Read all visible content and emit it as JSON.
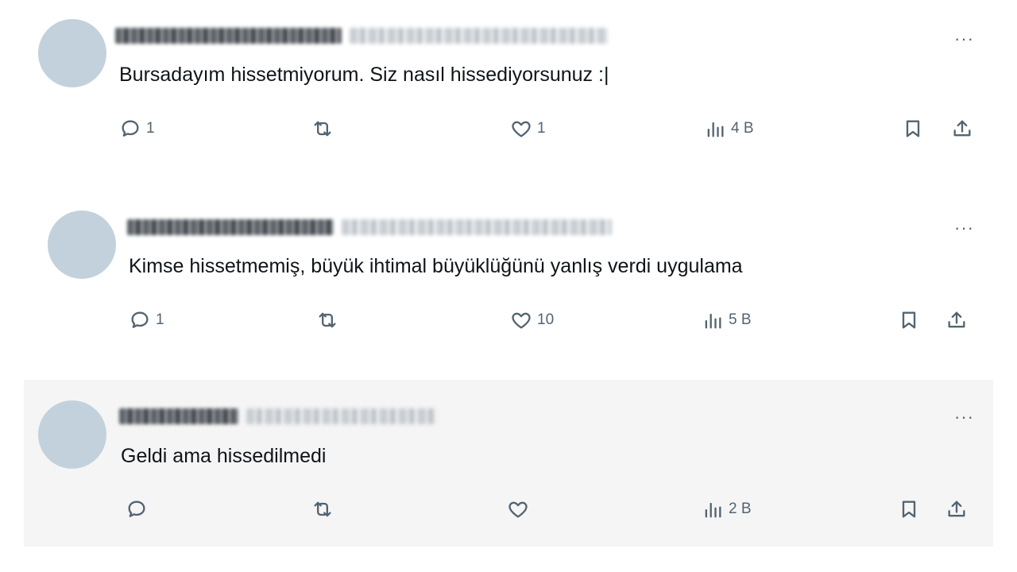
{
  "tweets": [
    {
      "text": "Bursadayım hissetmiyorum. Siz nasıl hissediyorsunuz :|",
      "replies": "1",
      "retweets": "",
      "likes": "1",
      "views": "4 B",
      "more_label": "···",
      "highlighted": false
    },
    {
      "text": "Kimse hissetmemiş, büyük ihtimal büyüklüğünü yanlış verdi uygulama",
      "replies": "1",
      "retweets": "",
      "likes": "10",
      "views": "5 B",
      "more_label": "···",
      "highlighted": false
    },
    {
      "text": "Geldi ama hissedilmedi",
      "replies": "",
      "retweets": "",
      "likes": "",
      "views": "2 B",
      "more_label": "···",
      "highlighted": true
    }
  ],
  "colors": {
    "icon": "#536471",
    "avatar": "#c3d1dc",
    "highlight_bg": "#f5f5f5"
  },
  "icons": [
    "reply-icon",
    "retweet-icon",
    "like-icon",
    "views-icon",
    "bookmark-icon",
    "share-icon",
    "more-icon"
  ]
}
